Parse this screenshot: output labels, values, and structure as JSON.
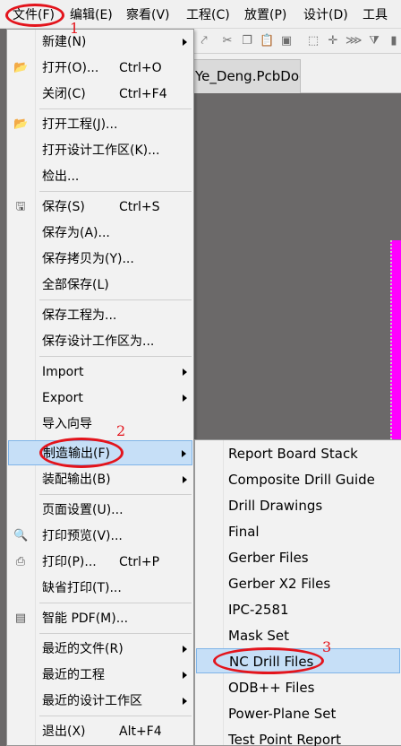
{
  "menubar": [
    "文件(F)",
    "编辑(E)",
    "察看(V)",
    "工程(C)",
    "放置(P)",
    "设计(D)",
    "工具"
  ],
  "doc_tab": "Ye_Deng.PcbDoc",
  "file_menu": [
    {
      "label": "新建(N)",
      "arrow": true
    },
    {
      "label": "打开(O)...",
      "shortcut": "Ctrl+O",
      "icon": "open-folder-icon"
    },
    {
      "label": "关闭(C)",
      "shortcut": "Ctrl+F4"
    },
    {
      "label": "打开工程(J)...",
      "icon": "open-project-icon"
    },
    {
      "label": "打开设计工作区(K)..."
    },
    {
      "label": "检出..."
    },
    {
      "label": "保存(S)",
      "shortcut": "Ctrl+S",
      "icon": "save-icon"
    },
    {
      "label": "保存为(A)..."
    },
    {
      "label": "保存拷贝为(Y)..."
    },
    {
      "label": "全部保存(L)"
    },
    {
      "label": "保存工程为..."
    },
    {
      "label": "保存设计工作区为..."
    },
    {
      "label": "Import",
      "arrow": true
    },
    {
      "label": "Export",
      "arrow": true
    },
    {
      "label": "导入向导"
    },
    {
      "label": "制造输出(F)",
      "arrow": true
    },
    {
      "label": "装配输出(B)",
      "arrow": true
    },
    {
      "label": "页面设置(U)..."
    },
    {
      "label": "打印预览(V)...",
      "icon": "print-preview-icon"
    },
    {
      "label": "打印(P)...",
      "shortcut": "Ctrl+P",
      "icon": "print-icon"
    },
    {
      "label": "缺省打印(T)..."
    },
    {
      "label": "智能 PDF(M)...",
      "icon": "smart-pdf-icon"
    },
    {
      "label": "最近的文件(R)",
      "arrow": true
    },
    {
      "label": "最近的工程",
      "arrow": true
    },
    {
      "label": "最近的设计工作区",
      "arrow": true
    },
    {
      "label": "退出(X)",
      "shortcut": "Alt+F4"
    }
  ],
  "fab_submenu": [
    "Report Board Stack",
    "Composite Drill Guide",
    "Drill Drawings",
    "Final",
    "Gerber Files",
    "Gerber X2 Files",
    "IPC-2581",
    "Mask Set",
    "NC Drill Files",
    "ODB++ Files",
    "Power-Plane Set",
    "Test Point Report"
  ],
  "annotations": [
    "1",
    "2",
    "3"
  ],
  "colors": {
    "highlight": "#c6dff7",
    "annotation": "#e3141c",
    "canvas": "#6b6969",
    "layer": "#ff00ff"
  }
}
